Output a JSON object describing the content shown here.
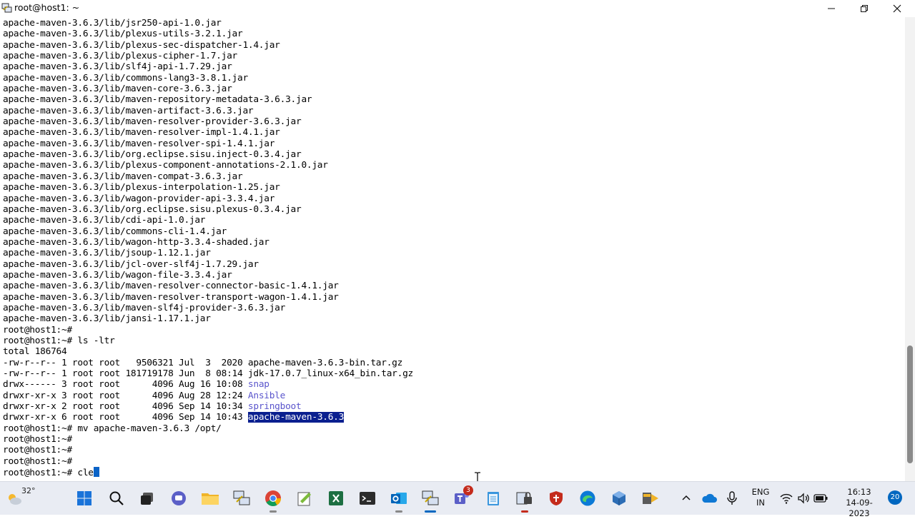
{
  "window": {
    "title": "root@host1: ~"
  },
  "terminal": {
    "lines": [
      "apache-maven-3.6.3/lib/jsr250-api-1.0.jar",
      "apache-maven-3.6.3/lib/plexus-utils-3.2.1.jar",
      "apache-maven-3.6.3/lib/plexus-sec-dispatcher-1.4.jar",
      "apache-maven-3.6.3/lib/plexus-cipher-1.7.jar",
      "apache-maven-3.6.3/lib/slf4j-api-1.7.29.jar",
      "apache-maven-3.6.3/lib/commons-lang3-3.8.1.jar",
      "apache-maven-3.6.3/lib/maven-core-3.6.3.jar",
      "apache-maven-3.6.3/lib/maven-repository-metadata-3.6.3.jar",
      "apache-maven-3.6.3/lib/maven-artifact-3.6.3.jar",
      "apache-maven-3.6.3/lib/maven-resolver-provider-3.6.3.jar",
      "apache-maven-3.6.3/lib/maven-resolver-impl-1.4.1.jar",
      "apache-maven-3.6.3/lib/maven-resolver-spi-1.4.1.jar",
      "apache-maven-3.6.3/lib/org.eclipse.sisu.inject-0.3.4.jar",
      "apache-maven-3.6.3/lib/plexus-component-annotations-2.1.0.jar",
      "apache-maven-3.6.3/lib/maven-compat-3.6.3.jar",
      "apache-maven-3.6.3/lib/plexus-interpolation-1.25.jar",
      "apache-maven-3.6.3/lib/wagon-provider-api-3.3.4.jar",
      "apache-maven-3.6.3/lib/org.eclipse.sisu.plexus-0.3.4.jar",
      "apache-maven-3.6.3/lib/cdi-api-1.0.jar",
      "apache-maven-3.6.3/lib/commons-cli-1.4.jar",
      "apache-maven-3.6.3/lib/wagon-http-3.3.4-shaded.jar",
      "apache-maven-3.6.3/lib/jsoup-1.12.1.jar",
      "apache-maven-3.6.3/lib/jcl-over-slf4j-1.7.29.jar",
      "apache-maven-3.6.3/lib/wagon-file-3.3.4.jar",
      "apache-maven-3.6.3/lib/maven-resolver-connector-basic-1.4.1.jar",
      "apache-maven-3.6.3/lib/maven-resolver-transport-wagon-1.4.1.jar",
      "apache-maven-3.6.3/lib/maven-slf4j-provider-3.6.3.jar",
      "apache-maven-3.6.3/lib/jansi-1.17.1.jar",
      "root@host1:~#",
      "root@host1:~# ls -ltr",
      "total 186764",
      "-rw-r--r-- 1 root root   9506321 Jul  3  2020 apache-maven-3.6.3-bin.tar.gz",
      "-rw-r--r-- 1 root root 181719178 Jun  8 08:14 jdk-17.0.7_linux-x64_bin.tar.gz"
    ],
    "dir_entries": [
      {
        "prefix": "drwx------ 3 root root      4096 Aug 16 10:08 ",
        "name": "snap"
      },
      {
        "prefix": "drwxr-xr-x 3 root root      4096 Aug 28 12:24 ",
        "name": "Ansible"
      },
      {
        "prefix": "drwxr-xr-x 2 root root      4096 Sep 14 10:34 ",
        "name": "springboot"
      },
      {
        "prefix": "drwxr-xr-x 6 root root      4096 Sep 14 10:43 ",
        "name": "apache-maven-3.6.3"
      }
    ],
    "after_lines": [
      "root@host1:~# mv apache-maven-3.6.3 /opt/",
      "root@host1:~#",
      "root@host1:~#",
      "root@host1:~#"
    ],
    "current_prompt": "root@host1:~# ",
    "current_input": "cle"
  },
  "taskbar": {
    "weather_temp": "32°",
    "teams_badge": "3",
    "language_line1": "ENG",
    "language_line2": "IN",
    "time": "16:13",
    "date": "14-09-2023",
    "notification_count": "20"
  },
  "colors": {
    "directory": "#5a55cc",
    "selection_bg": "#0a1f8f",
    "cursor": "#0a63c7",
    "taskbar_bg": "#e9ecf3"
  },
  "icons": [
    "putty-icon",
    "minimize-icon",
    "maximize-icon",
    "close-icon",
    "weather-icon",
    "windows-start-icon",
    "search-icon",
    "task-view-icon",
    "chat-icon",
    "file-explorer-icon",
    "putty-network-icon",
    "chrome-icon",
    "notepad-plus-icon",
    "excel-icon",
    "terminal-icon",
    "outlook-icon",
    "putty-active-icon",
    "teams-icon",
    "notepad-icon",
    "security-tool-icon",
    "shield-icon",
    "edge-icon",
    "virtualbox-icon",
    "winscp-icon",
    "chevron-up-icon",
    "onedrive-icon",
    "microphone-icon",
    "wifi-icon",
    "volume-icon",
    "battery-icon"
  ]
}
